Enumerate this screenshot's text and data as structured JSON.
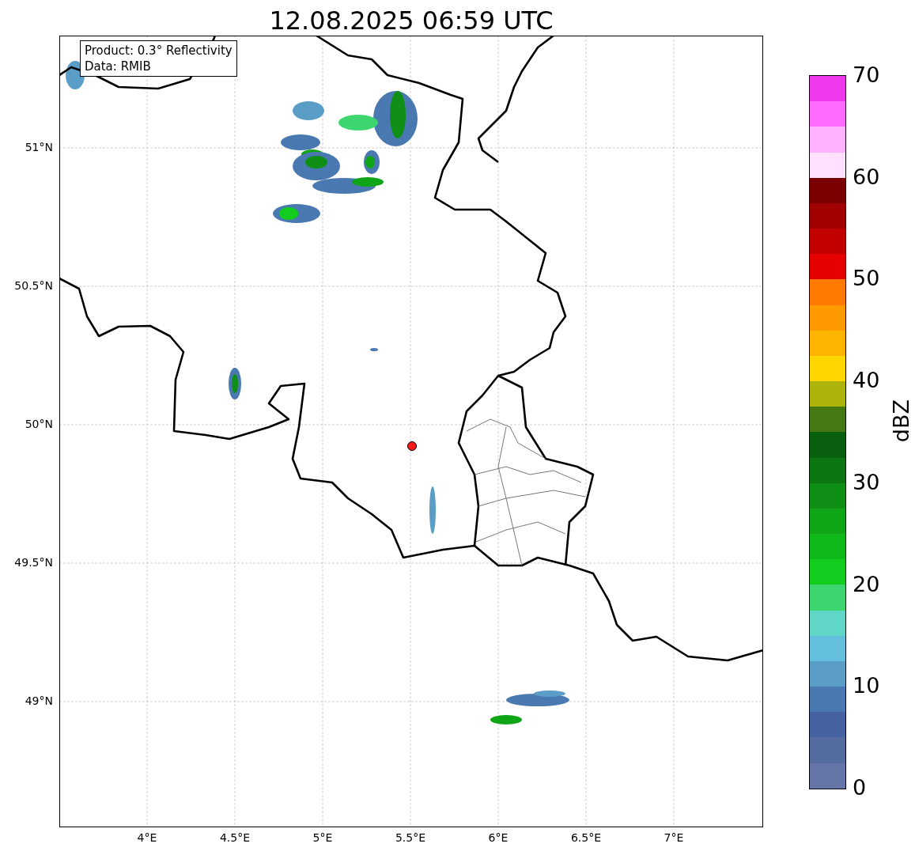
{
  "title": "12.08.2025 06:59 UTC",
  "info_box": {
    "lines": [
      "Product: 0.3° Reflectivity",
      "Data: RMIB"
    ]
  },
  "map": {
    "x_ticks": [
      "4°E",
      "4.5°E",
      "5°E",
      "5.5°E",
      "6°E",
      "6.5°E",
      "7°E"
    ],
    "y_ticks": [
      "51°N",
      "50.5°N",
      "50°N",
      "49.5°N",
      "49°N"
    ]
  },
  "colorbar": {
    "label": "dBZ",
    "ticks": [
      "70",
      "60",
      "50",
      "40",
      "30",
      "20",
      "10",
      "0"
    ],
    "bins": [
      {
        "color": "#6675a8"
      },
      {
        "color": "#536b9f"
      },
      {
        "color": "#4563a3"
      },
      {
        "color": "#4a78b0"
      },
      {
        "color": "#5a9ec8"
      },
      {
        "color": "#63bfdc"
      },
      {
        "color": "#5fd6c6"
      },
      {
        "color": "#3dd66e"
      },
      {
        "color": "#12cc1e"
      },
      {
        "color": "#10b91a"
      },
      {
        "color": "#10a516"
      },
      {
        "color": "#0f8f15"
      },
      {
        "color": "#0c7712"
      },
      {
        "color": "#085f0d"
      },
      {
        "color": "#467813"
      },
      {
        "color": "#adb30a"
      },
      {
        "color": "#ffd600"
      },
      {
        "color": "#ffb400"
      },
      {
        "color": "#ff9900"
      },
      {
        "color": "#ff7a00"
      },
      {
        "color": "#e60000"
      },
      {
        "color": "#c20000"
      },
      {
        "color": "#a00000"
      },
      {
        "color": "#7a0000"
      },
      {
        "color": "#ffe0ff"
      },
      {
        "color": "#ffb2ff"
      },
      {
        "color": "#ff6aff"
      },
      {
        "color": "#ee38ee"
      }
    ]
  }
}
